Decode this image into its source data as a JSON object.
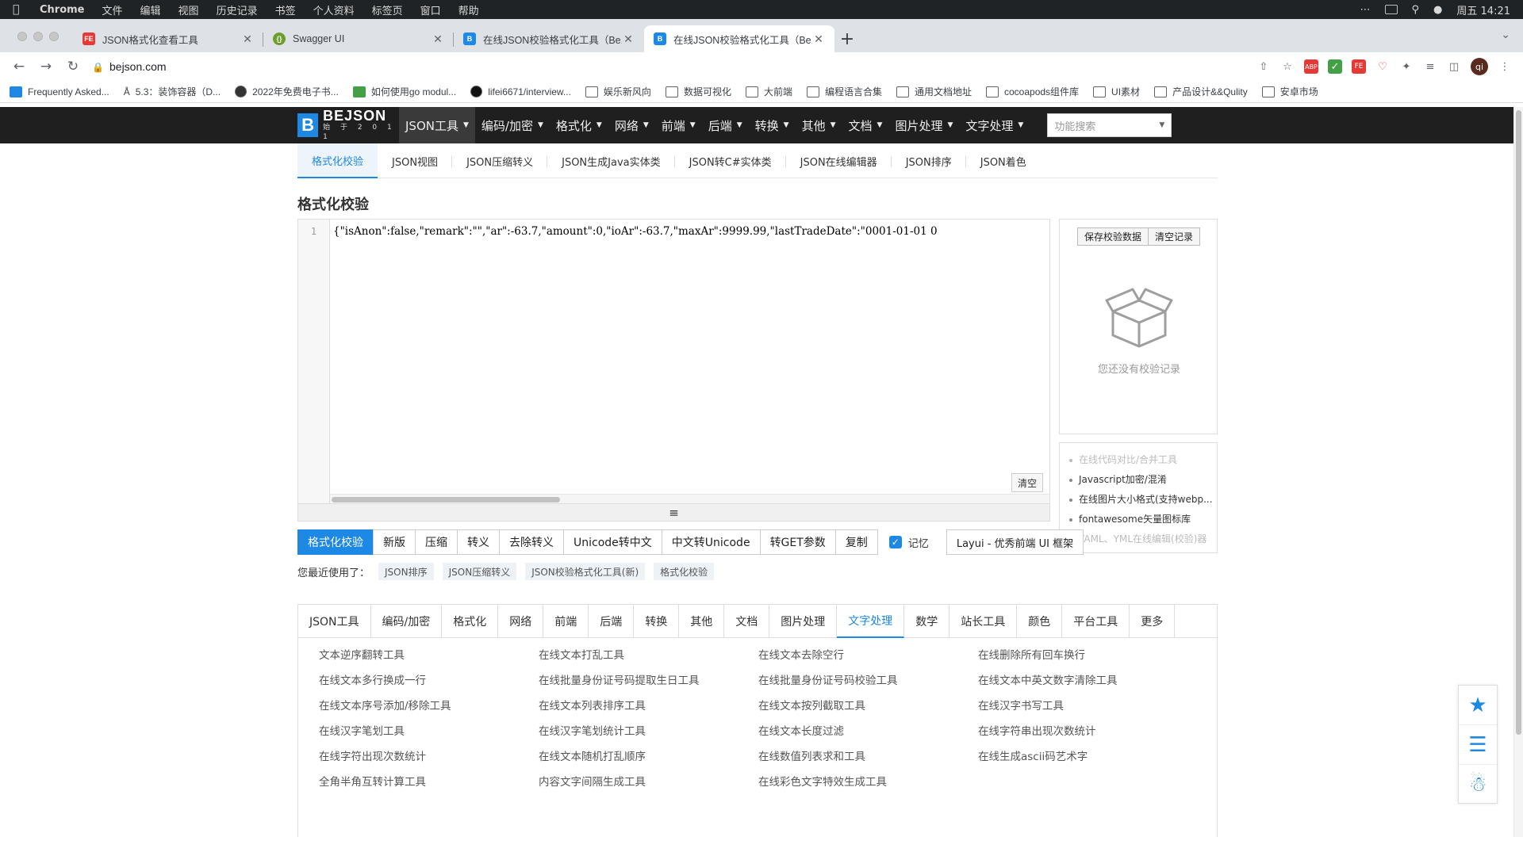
{
  "menubar": {
    "app": "Chrome",
    "items": [
      "文件",
      "编辑",
      "视图",
      "历史记录",
      "书签",
      "个人资料",
      "标签页",
      "窗口",
      "帮助"
    ],
    "clock": "周五 14:21"
  },
  "tabs": [
    {
      "title": "JSON格式化查看工具",
      "color": "#e53935",
      "glyph": "FE"
    },
    {
      "title": "Swagger UI",
      "color": "#6a9f2a",
      "glyph": "{}"
    },
    {
      "title": "在线JSON校验格式化工具（Be...",
      "color": "#1e88e5",
      "glyph": "B"
    },
    {
      "title": "在线JSON校验格式化工具（Be...",
      "color": "#1e88e5",
      "glyph": "B"
    }
  ],
  "address": {
    "url": "bejson.com"
  },
  "bookmarks": [
    "Frequently Asked...",
    "5.3：装饰容器（D...",
    "2022年免费电子书...",
    "如何使用go modul...",
    "lifei6671/interview...",
    "娱乐新风向",
    "数据可视化",
    "大前端",
    "编程语言合集",
    "通用文档地址",
    "cocoapods组件库",
    "UI素材",
    "产品设计&&Qulity",
    "安卓市场"
  ],
  "site": {
    "logo_title": "BEJSON",
    "logo_sub": "始 于 2 0 1 1",
    "nav": [
      "JSON工具",
      "编码/加密",
      "格式化",
      "网络",
      "前端",
      "后端",
      "转换",
      "其他",
      "文档",
      "图片处理",
      "文字处理"
    ],
    "search_placeholder": "功能搜索",
    "subtabs": [
      "格式化校验",
      "JSON视图",
      "JSON压缩转义",
      "JSON生成Java实体类",
      "JSON转C#实体类",
      "JSON在线编辑器",
      "JSON排序",
      "JSON着色"
    ],
    "page_title": "格式化校验",
    "editor": {
      "line_no": "1",
      "code": "{\"isAnon\":false,\"remark\":\"\",\"ar\":-63.7,\"amount\":0,\"ioAr\":-63.7,\"maxAr\":9999.99,\"lastTradeDate\":\"0001-01-01 0",
      "clear_label": "清空"
    },
    "record": {
      "save_btn": "保存校验数据",
      "clear_btn": "清空记录",
      "empty_text": "您还没有校验记录"
    },
    "links": [
      {
        "text": "在线代码对比/合并工具",
        "dark": false
      },
      {
        "text": "Javascript加密/混淆",
        "dark": true
      },
      {
        "text": "在线图片大小格式(支持webp...",
        "dark": true
      },
      {
        "text": "fontawesome矢量图标库",
        "dark": true
      },
      {
        "text": "YAML、YML在线编辑(校验)器",
        "dark": false
      }
    ],
    "buttons": [
      "格式化校验",
      "新版",
      "压缩",
      "转义",
      "去除转义",
      "Unicode转中文",
      "中文转Unicode",
      "转GET参数",
      "复制"
    ],
    "remember_label": "记忆",
    "layui_label": "Layui - 优秀前端 UI 框架",
    "recent_label": "您最近使用了：",
    "recent_tags": [
      "JSON排序",
      "JSON压缩转义",
      "JSON校验格式化工具(新)",
      "格式化校验"
    ],
    "tool_tabs": [
      "JSON工具",
      "编码/加密",
      "格式化",
      "网络",
      "前端",
      "后端",
      "转换",
      "其他",
      "文档",
      "图片处理",
      "文字处理",
      "数学",
      "站长工具",
      "颜色",
      "平台工具",
      "更多"
    ],
    "tools": [
      "文本逆序翻转工具",
      "在线文本打乱工具",
      "在线文本去除空行",
      "在线删除所有回车换行",
      "在线文本多行换成一行",
      "在线批量身份证号码提取生日工具",
      "在线批量身份证号码校验工具",
      "在线文本中英文数字清除工具",
      "在线文本序号添加/移除工具",
      "在线文本列表排序工具",
      "在线文本按列截取工具",
      "在线汉字书写工具",
      "在线汉字笔划工具",
      "在线汉字笔划统计工具",
      "在线文本长度过滤",
      "在线字符串出现次数统计",
      "在线字符出现次数统计",
      "在线文本随机打乱顺序",
      "在线数值列表求和工具",
      "在线生成ascii码艺术字",
      "全角半角互转计算工具",
      "内容文字间隔生成工具",
      "在线彩色文字特效生成工具"
    ]
  },
  "colors": {
    "accent": "#1e88e5",
    "nav_bg": "#1f1f1f"
  }
}
